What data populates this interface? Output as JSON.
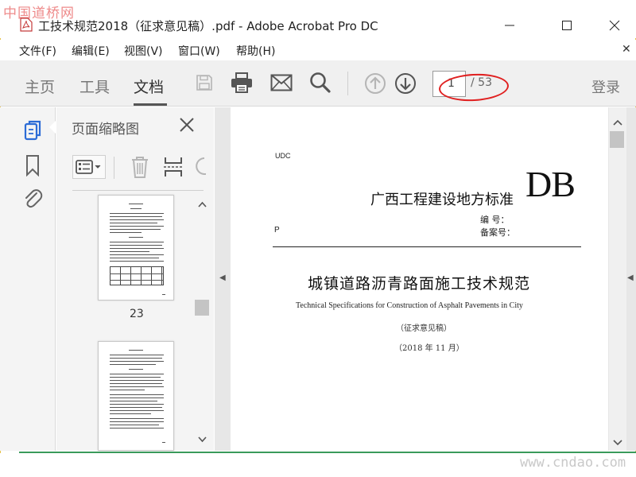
{
  "watermark_top": "中国道桥网",
  "watermark_bottom": "www.cndao.com",
  "window": {
    "title": "工技术规范2018（征求意见稿）.pdf - Adobe Acrobat Pro DC"
  },
  "menu": {
    "items": [
      {
        "label": "文件(F)"
      },
      {
        "label": "编辑(E)"
      },
      {
        "label": "视图(V)"
      },
      {
        "label": "窗口(W)"
      },
      {
        "label": "帮助(H)"
      }
    ]
  },
  "toolbar": {
    "tabs": [
      {
        "label": "主页"
      },
      {
        "label": "工具"
      },
      {
        "label": "文档"
      }
    ],
    "active_tab": "文档",
    "page_current": "1",
    "page_total": "/ 53",
    "login_label": "登录"
  },
  "sidebar": {
    "panel_title": "页面缩略图",
    "thumbnails": [
      {
        "page_label": "23"
      },
      {
        "page_label": ""
      }
    ]
  },
  "document": {
    "udc": "UDC",
    "standard_title": "广西工程建设地方标准",
    "db_mark": "DB",
    "code_label": "编    号：",
    "record_label": "备案号：",
    "p_label": "P",
    "title": "城镇道路沥青路面施工技术规范",
    "subtitle_en": "Technical Specifications for Construction of Asphalt Pavements in City",
    "draft_note": "（征求意见稿）",
    "date": "（2018 年 11 月）"
  },
  "colors": {
    "accent_blue": "#2c6cd6",
    "highlight_red": "#e02020",
    "bottom_green": "#3a9a5b",
    "toolbar_bg": "#f0f0f0"
  },
  "icons": {
    "app": "acrobat-pdf-icon",
    "save": "save-icon",
    "print": "print-icon",
    "email": "mail-icon",
    "search": "search-icon",
    "prev_page": "arrow-up-circle-icon",
    "next_page": "arrow-down-circle-icon",
    "thumbnails": "pages-icon",
    "bookmarks": "bookmark-icon",
    "attachments": "paperclip-icon"
  }
}
